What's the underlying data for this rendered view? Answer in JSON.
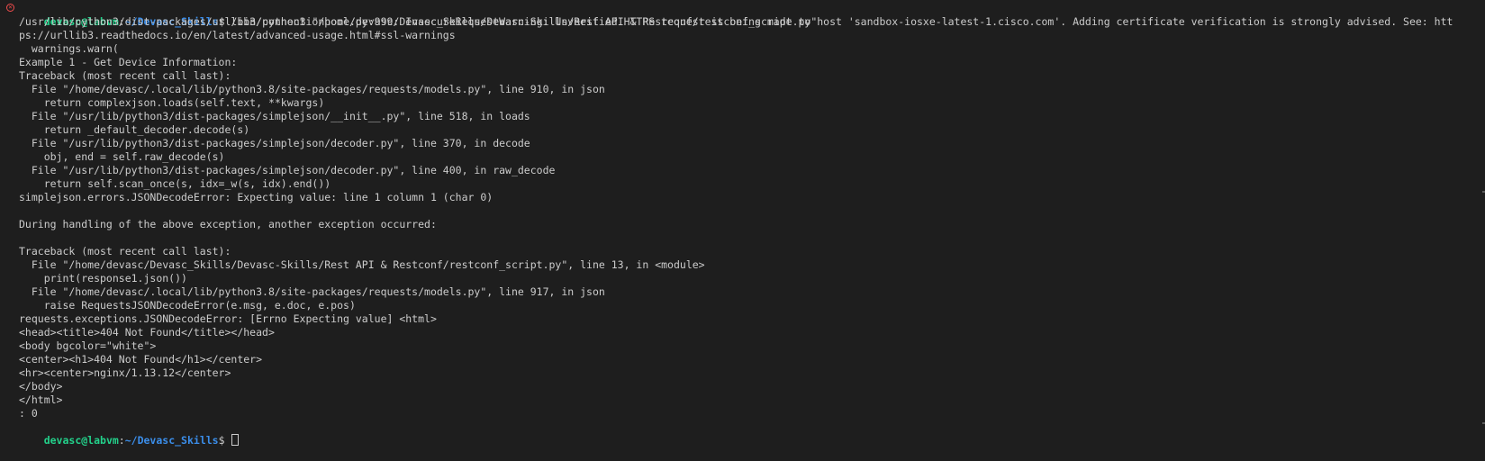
{
  "prompt": {
    "user_host": "devasc@labvm",
    "colon": ":",
    "path": "~/Devasc_Skills",
    "dollar": "$ "
  },
  "first_command": "/bin/python3 \"/home/devasc/Devasc_Skills/Devasc-Skills/Rest API & Restconf/restconf_script.py\"",
  "output_lines": [
    "/usr/lib/python3/dist-packages/urllib3/connectionpool.py:999: InsecureRequestWarning: Unverified HTTPS request is being made to host 'sandbox-iosxe-latest-1.cisco.com'. Adding certificate verification is strongly advised. See: htt",
    "ps://urllib3.readthedocs.io/en/latest/advanced-usage.html#ssl-warnings",
    "  warnings.warn(",
    "Example 1 - Get Device Information:",
    "Traceback (most recent call last):",
    "  File \"/home/devasc/.local/lib/python3.8/site-packages/requests/models.py\", line 910, in json",
    "    return complexjson.loads(self.text, **kwargs)",
    "  File \"/usr/lib/python3/dist-packages/simplejson/__init__.py\", line 518, in loads",
    "    return _default_decoder.decode(s)",
    "  File \"/usr/lib/python3/dist-packages/simplejson/decoder.py\", line 370, in decode",
    "    obj, end = self.raw_decode(s)",
    "  File \"/usr/lib/python3/dist-packages/simplejson/decoder.py\", line 400, in raw_decode",
    "    return self.scan_once(s, idx=_w(s, idx).end())",
    "simplejson.errors.JSONDecodeError: Expecting value: line 1 column 1 (char 0)",
    "",
    "During handling of the above exception, another exception occurred:",
    "",
    "Traceback (most recent call last):",
    "  File \"/home/devasc/Devasc_Skills/Devasc-Skills/Rest API & Restconf/restconf_script.py\", line 13, in <module>",
    "    print(response1.json())",
    "  File \"/home/devasc/.local/lib/python3.8/site-packages/requests/models.py\", line 917, in json",
    "    raise RequestsJSONDecodeError(e.msg, e.doc, e.pos)",
    "requests.exceptions.JSONDecodeError: [Errno Expecting value] <html>",
    "<head><title>404 Not Found</title></head>",
    "<body bgcolor=\"white\">",
    "<center><h1>404 Not Found</h1></center>",
    "<hr><center>nginx/1.13.12</center>",
    "</body>",
    "</html>",
    ": 0"
  ],
  "colors": {
    "background": "#1e1e1e",
    "text": "#cccccc",
    "user_host": "#23d18b",
    "path": "#3b8eea",
    "error_icon": "#f14c4c"
  },
  "icons": {
    "error_marker": "circle-x-icon"
  }
}
